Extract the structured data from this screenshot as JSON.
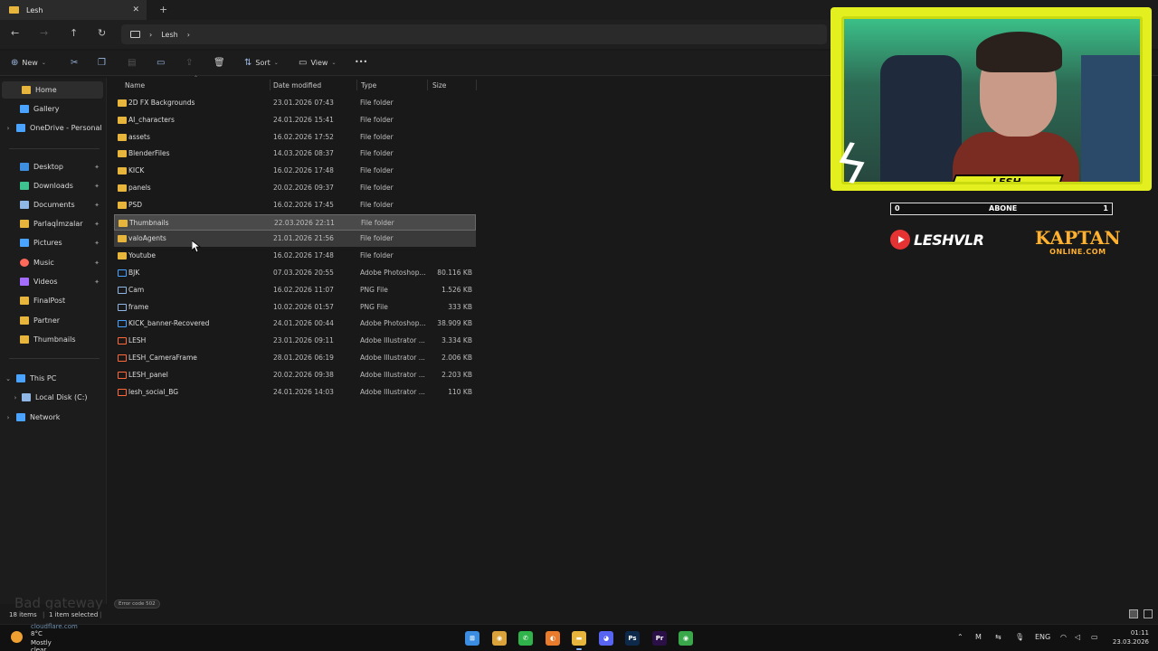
{
  "tab": {
    "title": "Lesh",
    "close": "✕",
    "new": "+"
  },
  "nav": {
    "back": "←",
    "forward": "→",
    "up": "↑",
    "refresh": "↻"
  },
  "address": {
    "sep1": "›",
    "folder": "Lesh",
    "sep2": "›"
  },
  "commands": {
    "new": "New",
    "sort": "Sort",
    "view": "View",
    "more": "•••"
  },
  "sidebar": {
    "items": [
      {
        "label": "Home",
        "icon": "home-icon",
        "color": "#e8b53c"
      },
      {
        "label": "Gallery",
        "icon": "gallery-icon",
        "color": "#4aa3ff"
      },
      {
        "label": "OneDrive - Personal",
        "icon": "cloud-icon",
        "color": "#4aa3ff"
      },
      {
        "label": "Desktop",
        "icon": "desktop-icon",
        "color": "#3e8fe0"
      },
      {
        "label": "Downloads",
        "icon": "download-icon",
        "color": "#3ec28f"
      },
      {
        "label": "Documents",
        "icon": "documents-icon",
        "color": "#8fb6e4"
      },
      {
        "label": "Parlaqİmzalar",
        "icon": "folder-icon",
        "color": "#e8b53c"
      },
      {
        "label": "Pictures",
        "icon": "pictures-icon",
        "color": "#4aa3ff"
      },
      {
        "label": "Music",
        "icon": "music-icon",
        "color": "#ff6a5a"
      },
      {
        "label": "Videos",
        "icon": "videos-icon",
        "color": "#a46cff"
      },
      {
        "label": "FinalPost",
        "icon": "folder-icon",
        "color": "#e8b53c"
      },
      {
        "label": "Partner",
        "icon": "folder-icon",
        "color": "#e8b53c"
      },
      {
        "label": "Thumbnails",
        "icon": "folder-icon",
        "color": "#e8b53c"
      },
      {
        "label": "This PC",
        "icon": "pc-icon",
        "color": "#4aa3ff"
      },
      {
        "label": "Local Disk (C:)",
        "icon": "disk-icon",
        "color": "#8fb6e4"
      },
      {
        "label": "Network",
        "icon": "network-icon",
        "color": "#4aa3ff"
      }
    ],
    "pin": "📌"
  },
  "columns": {
    "name": "Name",
    "date": "Date modified",
    "type": "Type",
    "size": "Size"
  },
  "files": [
    {
      "name": "2D FX Backgrounds",
      "date": "23.01.2026 07:43",
      "type": "File folder",
      "size": "",
      "kind": "folder"
    },
    {
      "name": "AI_characters",
      "date": "24.01.2026 15:41",
      "type": "File folder",
      "size": "",
      "kind": "folder"
    },
    {
      "name": "assets",
      "date": "16.02.2026 17:52",
      "type": "File folder",
      "size": "",
      "kind": "folder"
    },
    {
      "name": "BlenderFiles",
      "date": "14.03.2026 08:37",
      "type": "File folder",
      "size": "",
      "kind": "folder"
    },
    {
      "name": "KICK",
      "date": "16.02.2026 17:48",
      "type": "File folder",
      "size": "",
      "kind": "folder"
    },
    {
      "name": "panels",
      "date": "20.02.2026 09:37",
      "type": "File folder",
      "size": "",
      "kind": "folder"
    },
    {
      "name": "PSD",
      "date": "16.02.2026 17:45",
      "type": "File folder",
      "size": "",
      "kind": "folder"
    },
    {
      "name": "Thumbnails",
      "date": "22.03.2026 22:11",
      "type": "File folder",
      "size": "",
      "kind": "folder",
      "state": "sel"
    },
    {
      "name": "valoAgents",
      "date": "21.01.2026 21:56",
      "type": "File folder",
      "size": "",
      "kind": "folder",
      "state": "hover"
    },
    {
      "name": "Youtube",
      "date": "16.02.2026 17:48",
      "type": "File folder",
      "size": "",
      "kind": "folder"
    },
    {
      "name": "BJK",
      "date": "07.03.2026 20:55",
      "type": "Adobe Photoshop...",
      "size": "80.116 KB",
      "kind": "psd"
    },
    {
      "name": "Cam",
      "date": "16.02.2026 11:07",
      "type": "PNG File",
      "size": "1.526 KB",
      "kind": "png"
    },
    {
      "name": "frame",
      "date": "10.02.2026 01:57",
      "type": "PNG File",
      "size": "333 KB",
      "kind": "png"
    },
    {
      "name": "KICK_banner-Recovered",
      "date": "24.01.2026 00:44",
      "type": "Adobe Photoshop...",
      "size": "38.909 KB",
      "kind": "psd"
    },
    {
      "name": "LESH",
      "date": "23.01.2026 09:11",
      "type": "Adobe Illustrator ...",
      "size": "3.334 KB",
      "kind": "ai"
    },
    {
      "name": "LESH_CameraFrame",
      "date": "28.01.2026 06:19",
      "type": "Adobe Illustrator ...",
      "size": "2.006 KB",
      "kind": "ai"
    },
    {
      "name": "LESH_panel",
      "date": "20.02.2026 09:38",
      "type": "Adobe Illustrator ...",
      "size": "2.203 KB",
      "kind": "ai"
    },
    {
      "name": "lesh_social_BG",
      "date": "24.01.2026 14:03",
      "type": "Adobe Illustrator ...",
      "size": "110 KB",
      "kind": "ai"
    }
  ],
  "status": {
    "items": "18 items",
    "selected": "1 item selected"
  },
  "ghost": {
    "text": "Bad gateway",
    "error": "Error code 502",
    "cloudflare": "cloudflare.com"
  },
  "weather": {
    "temp": "8°C",
    "cond": "Mostly clear"
  },
  "tray": {
    "lang": "ENG",
    "time": "01:11",
    "date": "23.03.2026"
  },
  "taskbar_apps": [
    {
      "name": "start-icon",
      "glyph": "⊞",
      "color": "#3a8de0"
    },
    {
      "name": "chrome-icon",
      "glyph": "◉",
      "color": "#d9a23a"
    },
    {
      "name": "whatsapp-icon",
      "glyph": "✆",
      "color": "#2fb34a"
    },
    {
      "name": "blender-icon",
      "glyph": "◐",
      "color": "#e87b2c"
    },
    {
      "name": "file-explorer-icon",
      "glyph": "▬",
      "color": "#e8b53c",
      "active": true
    },
    {
      "name": "discord-icon",
      "glyph": "◕",
      "color": "#5865f2"
    },
    {
      "name": "photoshop-icon",
      "glyph": "Ps",
      "color": "#0d2a4a"
    },
    {
      "name": "premiere-icon",
      "glyph": "Pr",
      "color": "#2a1047"
    },
    {
      "name": "chrome-alt-icon",
      "glyph": "◉",
      "color": "#3aa84a"
    }
  ],
  "overlay": {
    "name": "LESH",
    "sub_left": "0",
    "sub_label": "ABONE",
    "sub_right": "1",
    "youtube": "LESHVLR",
    "kaptan_top": "KAPTAN",
    "kaptan_bottom": "ONLINE.COM",
    "accent": "#e3ef1e"
  }
}
